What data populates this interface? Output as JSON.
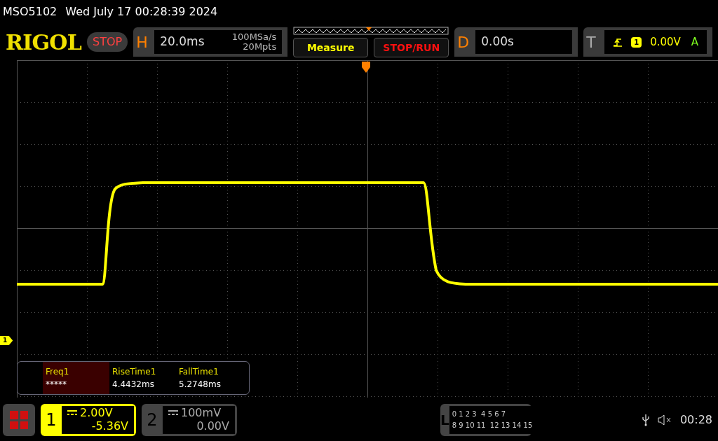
{
  "status_line": {
    "model": "MSO5102",
    "datetime": "Wed July 17 00:28:39 2024"
  },
  "logo": "RIGOL",
  "run_state": {
    "label": "STOP",
    "kind": "stop"
  },
  "horizontal": {
    "key": "H",
    "timebase": "20.0ms",
    "sample_rate": "100MSa/s",
    "memory_depth": "20Mpts"
  },
  "buttons": [
    {
      "label": "Measure",
      "kind": "measure"
    },
    {
      "label": "STOP/RUN",
      "kind": "run"
    }
  ],
  "delay": {
    "key": "D",
    "value": "0.00s"
  },
  "trigger": {
    "key": "T",
    "source": "1",
    "level": "0.00V",
    "mode": "A"
  },
  "channel_marker": "1",
  "measurements": [
    {
      "label": "Freq1",
      "value": "*****",
      "selected": true
    },
    {
      "label": "RiseTime1",
      "value": "4.4432ms",
      "selected": false
    },
    {
      "label": "FallTime1",
      "value": "5.2748ms",
      "selected": false
    }
  ],
  "channels": [
    {
      "number": "1",
      "scale": "2.00V",
      "offset": "-5.36V",
      "active": true
    },
    {
      "number": "2",
      "scale": "100mV",
      "offset": "0.00V",
      "active": false
    }
  ],
  "logic": {
    "key": "L",
    "rows": [
      "0 1 2 3  4 5 6 7",
      "8 9 10 11  12 13 14 15"
    ]
  },
  "clock": "00:28"
}
